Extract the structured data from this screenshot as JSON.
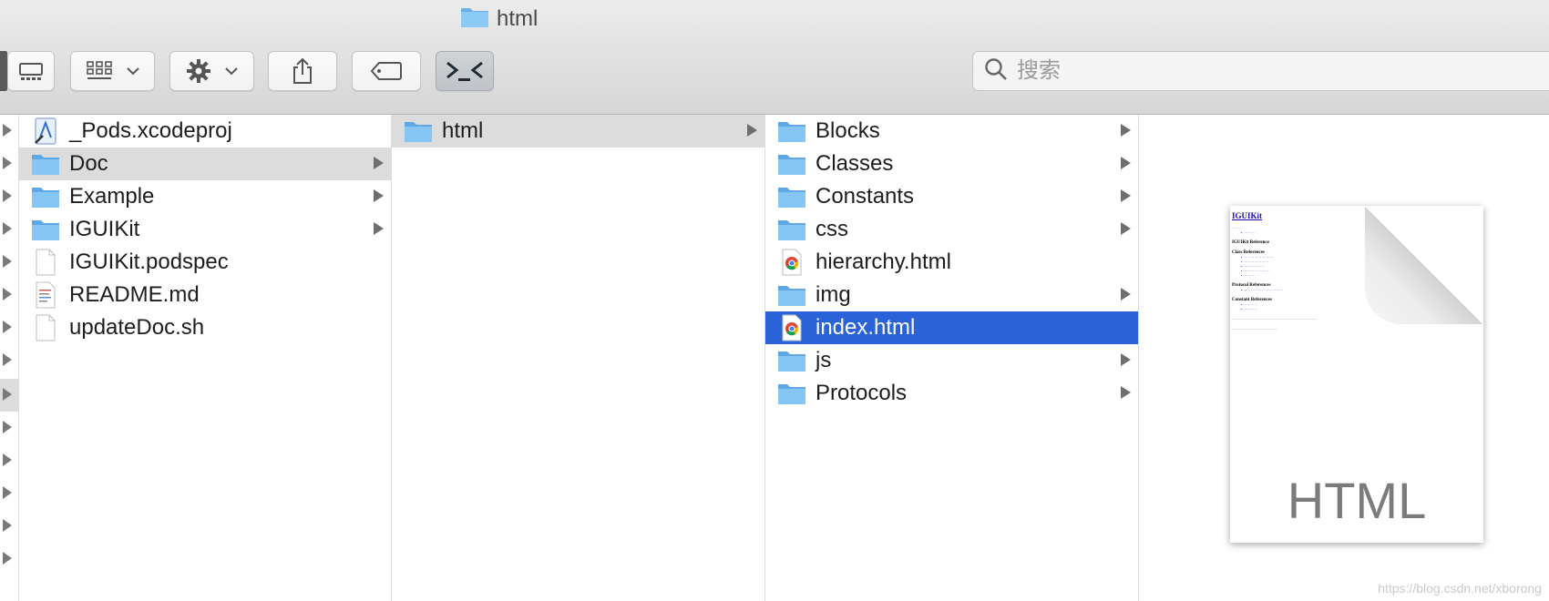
{
  "window": {
    "title": "html"
  },
  "toolbar": {
    "buttons": [
      {
        "name": "view-mode-button",
        "icon": "column-view-icon"
      },
      {
        "name": "group-button",
        "icon": "grid-group-icon"
      },
      {
        "name": "action-button",
        "icon": "gear-icon"
      },
      {
        "name": "share-button",
        "icon": "share-icon"
      },
      {
        "name": "tags-button",
        "icon": "tag-icon"
      },
      {
        "name": "terminal-button",
        "icon": "terminal-icon"
      }
    ],
    "search": {
      "placeholder": "搜索",
      "value": ""
    }
  },
  "columns": {
    "col1": [
      {
        "label": "_Pods.xcodeproj",
        "icon": "xcodeproj-icon",
        "folder": false
      },
      {
        "label": "Doc",
        "icon": "folder-icon",
        "folder": true,
        "selected": "grey"
      },
      {
        "label": "Example",
        "icon": "folder-icon",
        "folder": true
      },
      {
        "label": "IGUIKit",
        "icon": "folder-icon",
        "folder": true
      },
      {
        "label": "IGUIKit.podspec",
        "icon": "document-icon",
        "folder": false
      },
      {
        "label": "README.md",
        "icon": "markdown-icon",
        "folder": false
      },
      {
        "label": "updateDoc.sh",
        "icon": "document-icon",
        "folder": false
      }
    ],
    "col2": [
      {
        "label": "html",
        "icon": "folder-icon",
        "folder": true,
        "selected": "grey"
      }
    ],
    "col3": [
      {
        "label": "Blocks",
        "icon": "folder-icon",
        "folder": true
      },
      {
        "label": "Classes",
        "icon": "folder-icon",
        "folder": true
      },
      {
        "label": "Constants",
        "icon": "folder-icon",
        "folder": true
      },
      {
        "label": "css",
        "icon": "folder-icon",
        "folder": true
      },
      {
        "label": "hierarchy.html",
        "icon": "chrome-html-icon",
        "folder": false
      },
      {
        "label": "img",
        "icon": "folder-icon",
        "folder": true
      },
      {
        "label": "index.html",
        "icon": "chrome-html-icon",
        "folder": false,
        "selected": "blue"
      },
      {
        "label": "js",
        "icon": "folder-icon",
        "folder": true
      },
      {
        "label": "Protocols",
        "icon": "folder-icon",
        "folder": true
      }
    ]
  },
  "preview": {
    "file_type_label": "HTML",
    "doc_title": "IGUIKit",
    "doc_sections": [
      "IGUIKit Reference",
      "Class References",
      "Protocol References",
      "Constant References"
    ]
  },
  "watermark": "https://blog.csdn.net/xborong",
  "colors": {
    "selection_blue": "#2a62d8",
    "selection_grey": "#dcdcdc",
    "folder_blue": "#74b9ef"
  }
}
